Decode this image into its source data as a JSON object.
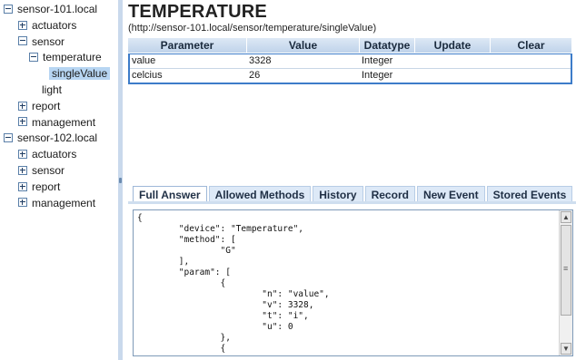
{
  "tree": {
    "items": [
      {
        "label": "sensor-101.local",
        "toggle": "minus",
        "indent": 0,
        "selected": false
      },
      {
        "label": "actuators",
        "toggle": "plus",
        "indent": 1,
        "selected": false
      },
      {
        "label": "sensor",
        "toggle": "minus",
        "indent": 1,
        "selected": false
      },
      {
        "label": "temperature",
        "toggle": "minus",
        "indent": 2,
        "selected": false
      },
      {
        "label": "singleValue",
        "toggle": "none",
        "indent": 3,
        "selected": true
      },
      {
        "label": "light",
        "toggle": "none",
        "indent": 2,
        "selected": false
      },
      {
        "label": "report",
        "toggle": "plus",
        "indent": 1,
        "selected": false
      },
      {
        "label": "management",
        "toggle": "plus",
        "indent": 1,
        "selected": false
      },
      {
        "label": "sensor-102.local",
        "toggle": "minus",
        "indent": 0,
        "selected": false
      },
      {
        "label": "actuators",
        "toggle": "plus",
        "indent": 1,
        "selected": false
      },
      {
        "label": "sensor",
        "toggle": "plus",
        "indent": 1,
        "selected": false
      },
      {
        "label": "report",
        "toggle": "plus",
        "indent": 1,
        "selected": false
      },
      {
        "label": "management",
        "toggle": "plus",
        "indent": 1,
        "selected": false
      }
    ]
  },
  "main": {
    "title": "TEMPERATURE",
    "subtitle": "(http://sensor-101.local/sensor/temperature/singleValue)",
    "table": {
      "headers": [
        "Parameter",
        "Value",
        "Datatype",
        "Update",
        "Clear"
      ],
      "rows": [
        [
          "value",
          "3328",
          "Integer",
          "",
          ""
        ],
        [
          "celcius",
          "26",
          "Integer",
          "",
          ""
        ]
      ]
    },
    "tabs": [
      "Full Answer",
      "Allowed Methods",
      "History",
      "Record",
      "New Event",
      "Stored Events"
    ],
    "active_tab": "Full Answer",
    "answer_text": "{\n        \"device\": \"Temperature\",\n        \"method\": [\n                \"G\"\n        ],\n        \"param\": [\n                {\n                        \"n\": \"value\",\n                        \"v\": 3328,\n                        \"t\": \"i\",\n                        \"u\": 0\n                },\n                {"
  },
  "colors": {
    "splitter": "#c9d9ec",
    "table_border": "#3d7cc9",
    "selected_highlight": "#b7d5f2",
    "tab_bg": "#dde9f7"
  }
}
